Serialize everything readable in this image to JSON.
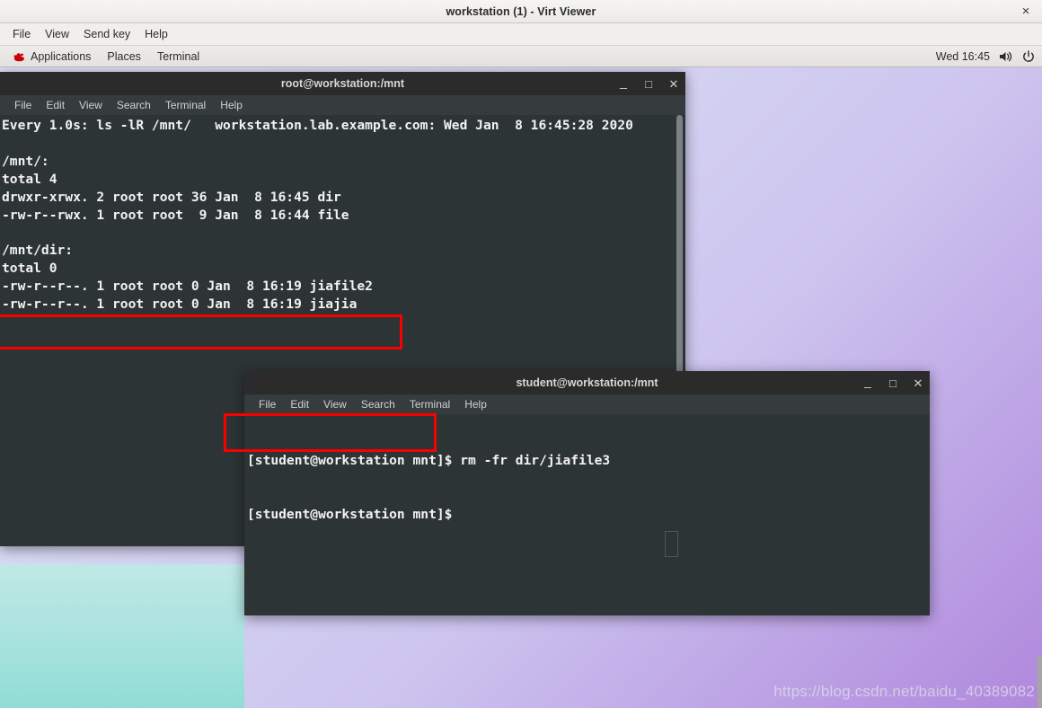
{
  "window": {
    "title": "workstation (1) - Virt Viewer",
    "close_label": "×",
    "menu": [
      "File",
      "View",
      "Send key",
      "Help"
    ]
  },
  "gnome_panel": {
    "logo_name": "red-hat-icon",
    "items": [
      "Applications",
      "Places",
      "Terminal"
    ],
    "clock": "Wed 16:45",
    "volume_icon": "volume-icon",
    "power_icon": "power-icon"
  },
  "terminal_root": {
    "title": "root@workstation:/mnt",
    "menu": [
      "File",
      "Edit",
      "View",
      "Search",
      "Terminal",
      "Help"
    ],
    "buttons": {
      "minimize": "_",
      "maximize": "□",
      "close": "✕"
    },
    "content": "Every 1.0s: ls -lR /mnt/   workstation.lab.example.com: Wed Jan  8 16:45:28 2020\n\n/mnt/:\ntotal 4\ndrwxr-xrwx. 2 root root 36 Jan  8 16:45 dir\n-rw-r--rwx. 1 root root  9 Jan  8 16:44 file\n\n/mnt/dir:\ntotal 0\n-rw-r--r--. 1 root root 0 Jan  8 16:19 jiafile2\n-rw-r--r--. 1 root root 0 Jan  8 16:19 jiajia"
  },
  "terminal_student": {
    "title": "student@workstation:/mnt",
    "menu": [
      "File",
      "Edit",
      "View",
      "Search",
      "Terminal",
      "Help"
    ],
    "buttons": {
      "minimize": "_",
      "maximize": "□",
      "close": "✕"
    },
    "prompt_line_1": "[student@workstation mnt]$ ",
    "command_1": "rm -fr dir/jiafile3",
    "prompt_line_2": "[student@workstation mnt]$ "
  },
  "annotations": {
    "highlight_color": "#f80000",
    "box_empty_output": "",
    "box_command": "rm -fr dir/jiafile3"
  },
  "watermark": "https://blog.csdn.net/baidu_40389082"
}
